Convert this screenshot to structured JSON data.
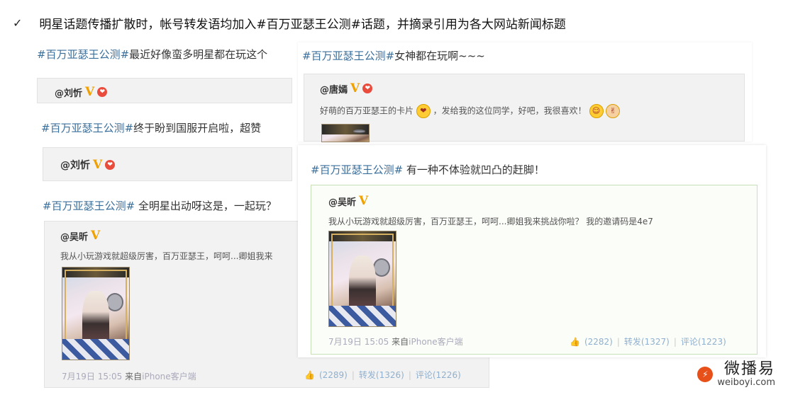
{
  "headline": {
    "check": "✓",
    "text": "明星话题传播扩散时，帐号转发语均加入#百万亚瑟王公测#话题，并摘录引用为各大网站新闻标题"
  },
  "left_panel": {
    "post1": {
      "tag": "#百万亚瑟王公测#",
      "text": "最近好像蛮多明星都在玩这个",
      "author": "@刘忻"
    },
    "post2": {
      "tag": "#百万亚瑟王公测#",
      "text": "终于盼到国服开启啦，超赞",
      "author": "@刘忻"
    },
    "post3": {
      "tag": "#百万亚瑟王公测#",
      "text": " 全明星出动呀这是，一起玩？",
      "author": "@吴昕",
      "quote": "我从小玩游戏就超级厉害，百万亚瑟王，呵呵...卿姐我来",
      "time": "7月19日 15:05",
      "from": "来自",
      "client": "iPhone客户端",
      "likes": "(2289)",
      "repost": "转发(1326)",
      "comments": "评论(1226)"
    }
  },
  "right_top_panel": {
    "tag": "#百万亚瑟王公测#",
    "text": "女神都在玩啊~~~",
    "author": "@唐嫣",
    "quote_part1": "好萌的百万亚瑟王的卡片",
    "quote_part2": "，发给我的这位同学，好吧，我很喜欢！"
  },
  "front_panel": {
    "tag": "#百万亚瑟王公测#",
    "text": " 有一种不体验就凹凸的赶脚！",
    "author": "@吴昕",
    "quote": "我从小玩游戏就超级厉害，百万亚瑟王，呵呵...卿姐我来挑战你啦？ 我的邀请码是4e7",
    "time": "7月19日 15:05",
    "from": "来自",
    "client": "iPhone客户端",
    "likes": "(2282)",
    "repost": "转发(1327)",
    "comments": "评论(1223)"
  },
  "logo": {
    "cn": "微播易",
    "en": "weiboyi.com"
  },
  "colors": {
    "tag": "#3a6f9c",
    "badge": "#f0a000",
    "logo": "#e8501a"
  },
  "icons": {
    "verified": "V",
    "heart": "❤",
    "like": "👍",
    "smile": "☺",
    "victory": "✌"
  }
}
